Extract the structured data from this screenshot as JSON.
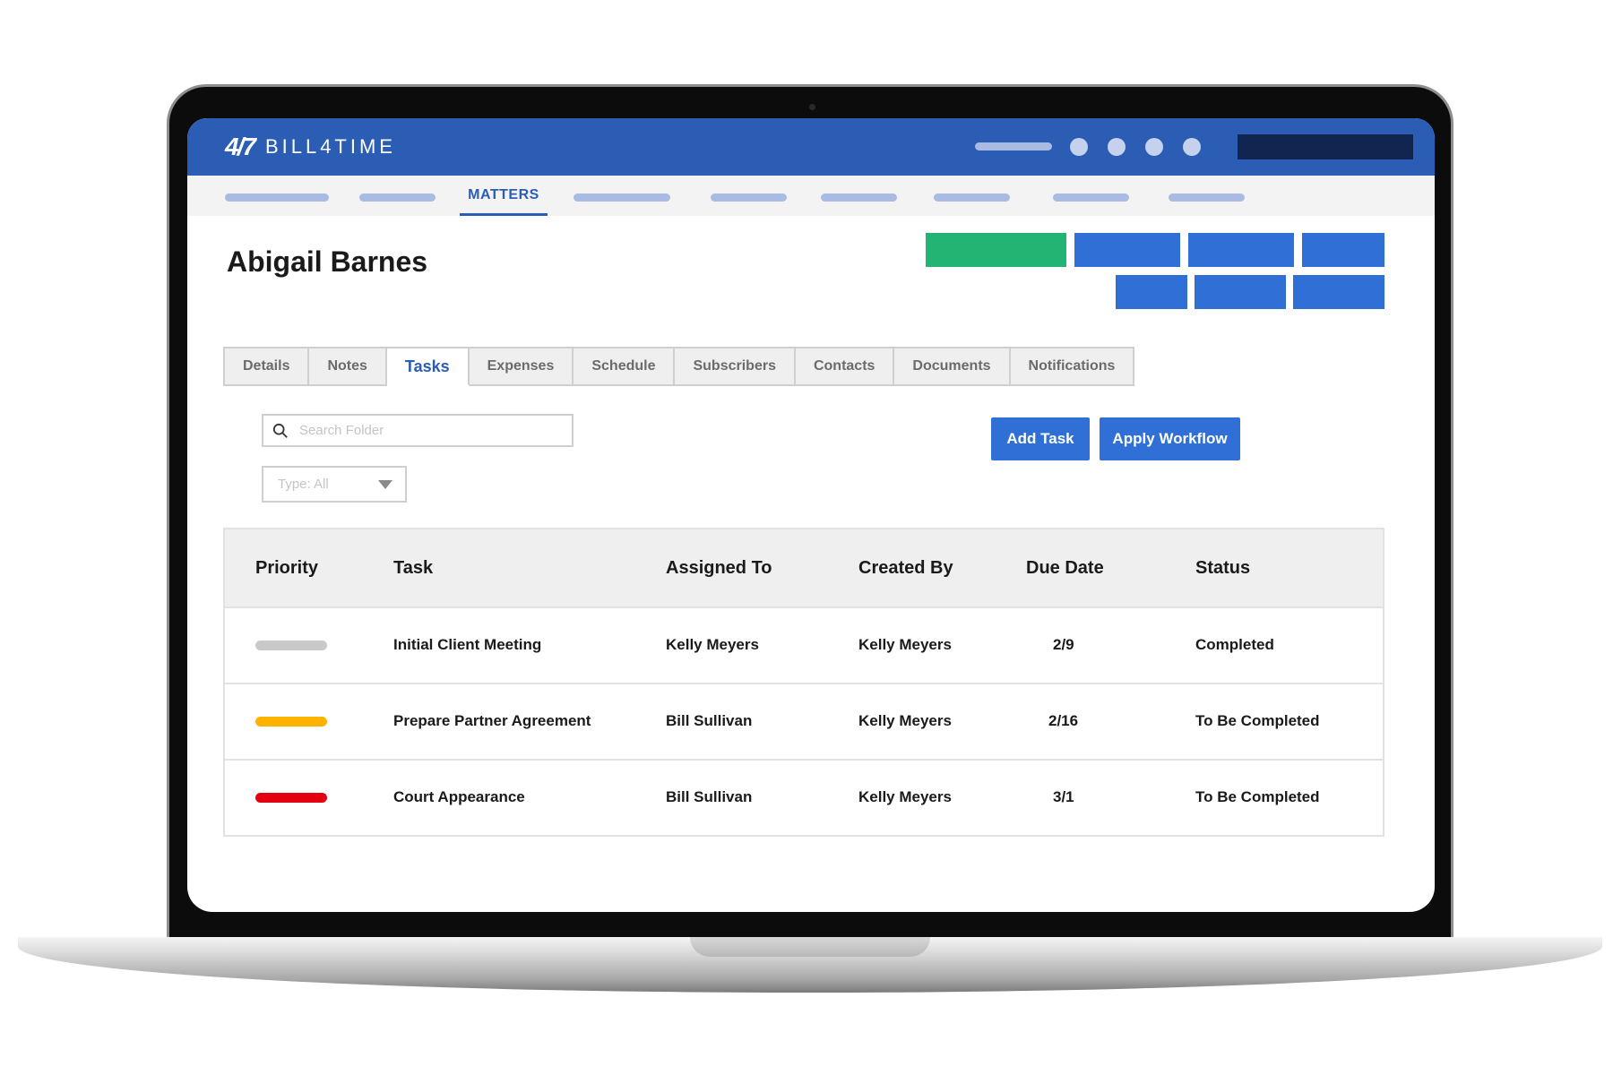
{
  "app": {
    "brand": "BILL4TIME",
    "brand_mark": "4/7"
  },
  "nav": {
    "active_label": "MATTERS"
  },
  "matter": {
    "client_name": "Abigail Barnes"
  },
  "tabs": [
    "Details",
    "Notes",
    "Tasks",
    "Expenses",
    "Schedule",
    "Subscribers",
    "Contacts",
    "Documents",
    "Notifications"
  ],
  "active_tab": "Tasks",
  "search": {
    "placeholder": "Search Folder"
  },
  "filter": {
    "type_label": "Type: All"
  },
  "actions": {
    "add_task": "Add Task",
    "apply_workflow": "Apply Workflow"
  },
  "table": {
    "headers": [
      "Priority",
      "Task",
      "Assigned To",
      "Created By",
      "Due Date",
      "Status"
    ],
    "rows": [
      {
        "priority_color": "#c9c9c9",
        "task": "Initial Client Meeting",
        "assigned_to": "Kelly Meyers",
        "created_by": "Kelly Meyers",
        "due_date": "2/9",
        "status": "Completed"
      },
      {
        "priority_color": "#ffb300",
        "task": "Prepare Partner Agreement",
        "assigned_to": "Bill Sullivan",
        "created_by": "Kelly Meyers",
        "due_date": "2/16",
        "status": "To Be Completed"
      },
      {
        "priority_color": "#e3000f",
        "task": "Court Appearance",
        "assigned_to": "Bill Sullivan",
        "created_by": "Kelly Meyers",
        "due_date": "3/1",
        "status": "To Be Completed"
      }
    ]
  },
  "colors": {
    "brand_blue": "#2a5db3",
    "button_blue": "#2f6fd6",
    "green": "#22b473"
  },
  "icons": {
    "search": "search-icon",
    "dropdown": "chevron-down-icon"
  }
}
